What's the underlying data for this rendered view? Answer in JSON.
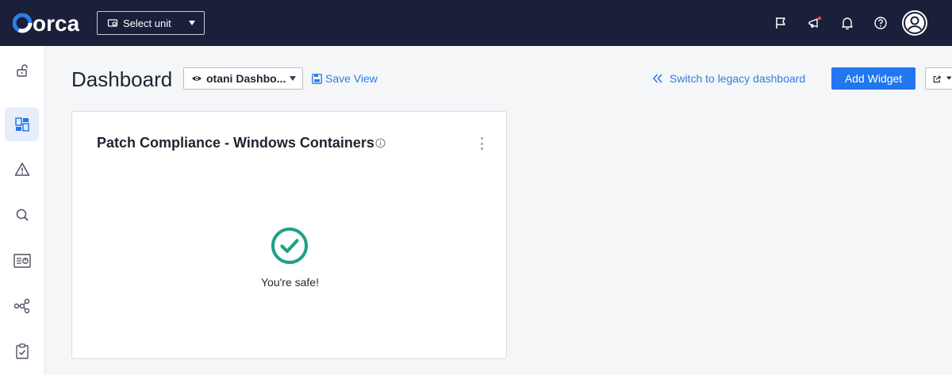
{
  "header": {
    "logo_text": "orca",
    "unit_select": {
      "label": "Select unit"
    },
    "icons": [
      "flag-icon",
      "megaphone-icon",
      "bell-icon",
      "help-icon",
      "avatar-icon"
    ],
    "notification_dot_color": "#e8414a"
  },
  "sidebar": {
    "items": [
      {
        "name": "unlock-icon",
        "active": false
      },
      {
        "name": "dashboard-icon",
        "active": true
      },
      {
        "name": "alert-icon",
        "active": false
      },
      {
        "name": "search-icon",
        "active": false
      },
      {
        "name": "reports-icon",
        "active": false
      },
      {
        "name": "graph-icon",
        "active": false
      },
      {
        "name": "compliance-icon",
        "active": false
      }
    ]
  },
  "page": {
    "title": "Dashboard",
    "dashboard_select": {
      "label": "otani Dashbo..."
    },
    "save_view_label": "Save View",
    "legacy_link_label": "Switch to legacy dashboard",
    "add_widget_label": "Add Widget"
  },
  "widget": {
    "title": "Patch Compliance - Windows Containers",
    "status_text": "You're safe!",
    "status_color": "#1fa187"
  },
  "colors": {
    "topbar": "#1a1f3a",
    "accent": "#2277ee",
    "link": "#2d7ee6"
  }
}
